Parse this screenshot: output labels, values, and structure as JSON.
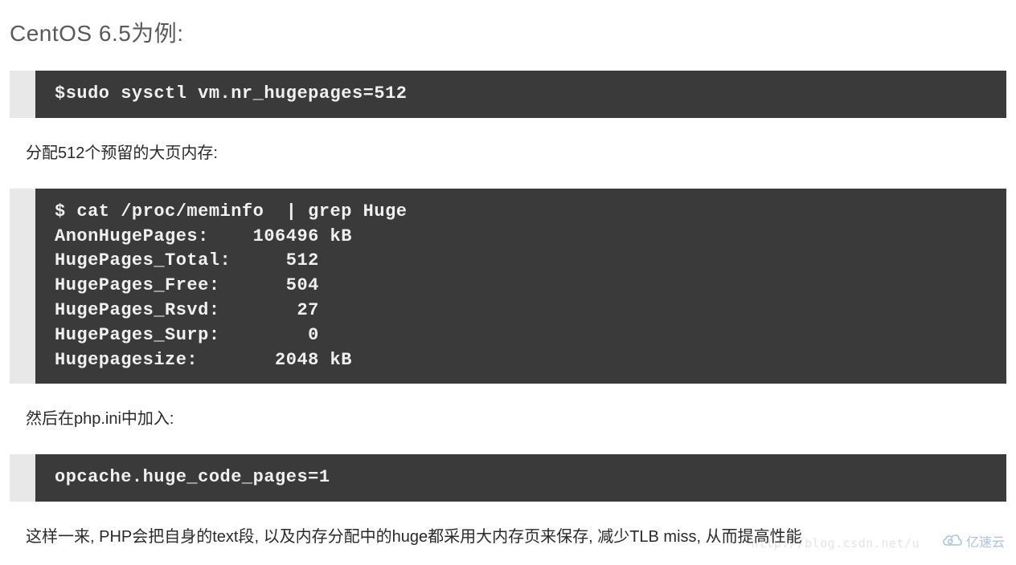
{
  "heading": "CentOS 6.5为例:",
  "code_block_1": "$sudo sysctl vm.nr_hugepages=512",
  "paragraph_1": "分配512个预留的大页内存:",
  "code_block_2": "$ cat /proc/meminfo  | grep Huge\nAnonHugePages:    106496 kB\nHugePages_Total:     512\nHugePages_Free:      504\nHugePages_Rsvd:       27\nHugePages_Surp:        0\nHugepagesize:       2048 kB",
  "paragraph_2": "然后在php.ini中加入:",
  "code_block_3": "opcache.huge_code_pages=1",
  "paragraph_3": "这样一来, PHP会把自身的text段, 以及内存分配中的huge都采用大内存页来保存, 减少TLB miss, 从而提高性能",
  "watermark_url": "http://blog.csdn.net/u",
  "watermark_text": "亿速云"
}
